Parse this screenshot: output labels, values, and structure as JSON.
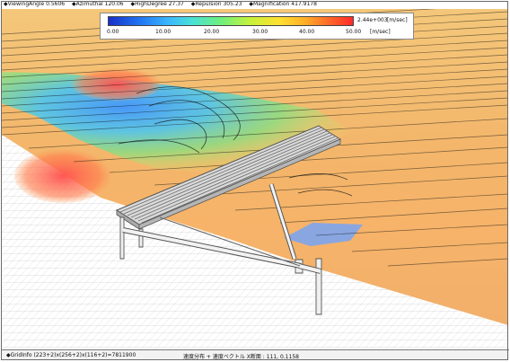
{
  "viewer": {
    "status": {
      "viewing_angle": "◆ViewingAngle 0.5606",
      "azimuthal": "◆Azimuthal 120.06",
      "high_degree": "◆HighDegree 27.37",
      "repulsion": "◆Repulsion 305.23",
      "magnification": "◆Magnification 417.9178"
    },
    "legend": {
      "max_value": "2.44e+003",
      "unit_top": "[m/sec]",
      "unit_bottom": "[m/sec]",
      "ticks": [
        "0.00",
        "10.00",
        "20.00",
        "30.00",
        "40.00",
        "50.00"
      ],
      "colors": [
        "#1830c8",
        "#2070f0",
        "#39b5ff",
        "#48e0d8",
        "#6ef07c",
        "#c7f23a",
        "#ffe030",
        "#ffb128",
        "#ff6a2a",
        "#ff2a2a"
      ]
    },
    "bottom": {
      "grid_info": "◆GridInfo (223+2)x(256+2)x(116+2)=7811900",
      "section_info": "速度分布 + 速度ベクトル X断面 : 111, 0.1158"
    }
  }
}
